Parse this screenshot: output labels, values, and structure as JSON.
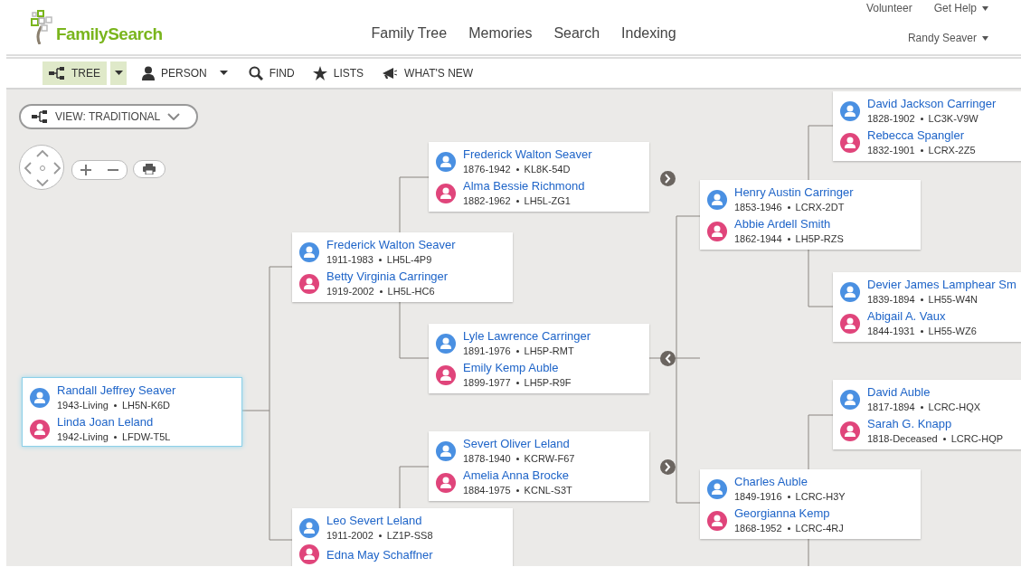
{
  "header": {
    "logo": "FamilySearch",
    "nav": [
      {
        "label": "Family Tree"
      },
      {
        "label": "Memories"
      },
      {
        "label": "Search"
      },
      {
        "label": "Indexing"
      }
    ],
    "utility": [
      {
        "label": "Volunteer",
        "dropdown": false
      },
      {
        "label": "Get Help",
        "dropdown": true
      }
    ],
    "user": {
      "label": "Randy Seaver",
      "dropdown": true
    }
  },
  "toolbar": [
    {
      "label": "TREE",
      "kind": "tree",
      "selected": true,
      "dropdown": true
    },
    {
      "label": "PERSON",
      "kind": "person",
      "selected": false,
      "dropdown": true
    },
    {
      "label": "FIND",
      "kind": "find",
      "selected": false,
      "dropdown": false
    },
    {
      "label": "LISTS",
      "kind": "lists",
      "selected": false,
      "dropdown": false
    },
    {
      "label": "WHAT'S NEW",
      "kind": "news",
      "selected": false,
      "dropdown": false
    }
  ],
  "view": {
    "label": "VIEW: TRADITIONAL"
  },
  "couples": [
    {
      "selected": true,
      "husband": {
        "name": "Randall Jeffrey Seaver",
        "dates": "1943-Living",
        "id": "LH5N-K6D"
      },
      "wife": {
        "name": "Linda Joan Leland",
        "dates": "1942-Living",
        "id": "LFDW-T5L"
      }
    },
    {
      "selected": false,
      "husband": {
        "name": "Frederick Walton Seaver",
        "dates": "1911-1983",
        "id": "LH5L-4P9"
      },
      "wife": {
        "name": "Betty Virginia Carringer",
        "dates": "1919-2002",
        "id": "LH5L-HC6"
      }
    },
    {
      "selected": false,
      "husband": {
        "name": "Leo Severt Leland",
        "dates": "1911-2002",
        "id": "LZ1P-SS8"
      },
      "wife": {
        "name": "Edna May Schaffner"
      }
    },
    {
      "selected": false,
      "husband": {
        "name": "Frederick Walton Seaver",
        "dates": "1876-1942",
        "id": "KL8K-54D"
      },
      "wife": {
        "name": "Alma Bessie Richmond",
        "dates": "1882-1962",
        "id": "LH5L-ZG1"
      }
    },
    {
      "selected": false,
      "husband": {
        "name": "Lyle Lawrence Carringer",
        "dates": "1891-1976",
        "id": "LH5P-RMT"
      },
      "wife": {
        "name": "Emily Kemp Auble",
        "dates": "1899-1977",
        "id": "LH5P-R9F"
      }
    },
    {
      "selected": false,
      "husband": {
        "name": "Severt Oliver Leland",
        "dates": "1878-1940",
        "id": "KCRW-F67"
      },
      "wife": {
        "name": "Amelia Anna Brocke",
        "dates": "1884-1975",
        "id": "KCNL-S3T"
      }
    },
    {
      "selected": false,
      "husband": {
        "name": "David Jackson Carringer",
        "dates": "1828-1902",
        "id": "LC3K-V9W"
      },
      "wife": {
        "name": "Rebecca Spangler",
        "dates": "1832-1901",
        "id": "LCRX-2Z5"
      }
    },
    {
      "selected": false,
      "husband": {
        "name": "Henry Austin Carringer",
        "dates": "1853-1946",
        "id": "LCRX-2DT"
      },
      "wife": {
        "name": "Abbie Ardell Smith",
        "dates": "1862-1944",
        "id": "LH5P-RZS"
      }
    },
    {
      "selected": false,
      "husband": {
        "name": "Devier James Lamphear Sm",
        "dates": "1839-1894",
        "id": "LH55-W4N"
      },
      "wife": {
        "name": "Abigail A. Vaux",
        "dates": "1844-1931",
        "id": "LH55-WZ6"
      }
    },
    {
      "selected": false,
      "husband": {
        "name": "David Auble",
        "dates": "1817-1894",
        "id": "LCRC-HQX"
      },
      "wife": {
        "name": "Sarah G. Knapp",
        "dates": "1818-Deceased",
        "id": "LCRC-HQP"
      }
    },
    {
      "selected": false,
      "husband": {
        "name": "Charles Auble",
        "dates": "1849-1916",
        "id": "LCRC-H3Y"
      },
      "wife": {
        "name": "Georgianna Kemp",
        "dates": "1868-1952",
        "id": "LCRC-4RJ"
      }
    }
  ],
  "expanders": [
    {
      "kind": "next"
    },
    {
      "kind": "prev"
    },
    {
      "kind": "next"
    }
  ]
}
